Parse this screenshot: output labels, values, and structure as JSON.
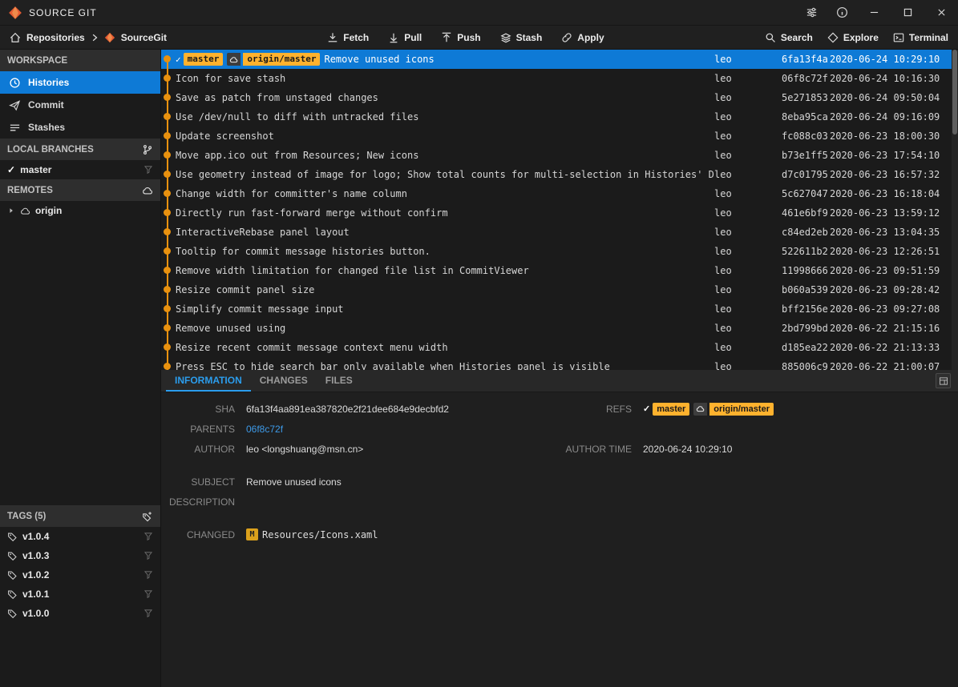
{
  "titlebar": {
    "title": "SOURCE GIT"
  },
  "toolbar": {
    "breadcrumb": {
      "root": "Repositories",
      "repo": "SourceGit"
    },
    "actions": [
      {
        "name": "fetch",
        "label": "Fetch"
      },
      {
        "name": "pull",
        "label": "Pull"
      },
      {
        "name": "push",
        "label": "Push"
      },
      {
        "name": "stash",
        "label": "Stash"
      },
      {
        "name": "apply",
        "label": "Apply"
      }
    ],
    "right_actions": [
      {
        "name": "search",
        "label": "Search"
      },
      {
        "name": "explore",
        "label": "Explore"
      },
      {
        "name": "terminal",
        "label": "Terminal"
      }
    ]
  },
  "sidebar": {
    "workspace_header": "WORKSPACE",
    "workspace_items": [
      {
        "name": "histories",
        "label": "Histories",
        "selected": true
      },
      {
        "name": "commit",
        "label": "Commit",
        "selected": false
      },
      {
        "name": "stashes",
        "label": "Stashes",
        "selected": false
      }
    ],
    "local_branches_header": "LOCAL BRANCHES",
    "branches": [
      {
        "label": "master",
        "current": true
      }
    ],
    "remotes_header": "REMOTES",
    "remotes": [
      {
        "label": "origin"
      }
    ],
    "tags_header": "TAGS (5)",
    "tags": [
      {
        "label": "v1.0.4"
      },
      {
        "label": "v1.0.3"
      },
      {
        "label": "v1.0.2"
      },
      {
        "label": "v1.0.1"
      },
      {
        "label": "v1.0.0"
      }
    ]
  },
  "history": {
    "commits": [
      {
        "refs": [
          {
            "type": "head",
            "name": "master"
          },
          {
            "type": "remote",
            "name": "origin/master"
          }
        ],
        "subject": "Remove unused icons",
        "author": "leo",
        "sha": "6fa13f4a",
        "time": "2020-06-24 10:29:10",
        "selected": true
      },
      {
        "subject": "Icon for save stash",
        "author": "leo",
        "sha": "06f8c72f",
        "time": "2020-06-24 10:16:30"
      },
      {
        "subject": "Save as patch from unstaged changes",
        "author": "leo",
        "sha": "5e271853",
        "time": "2020-06-24 09:50:04"
      },
      {
        "subject": "Use /dev/null to diff with untracked files",
        "author": "leo",
        "sha": "8eba95ca",
        "time": "2020-06-24 09:16:09"
      },
      {
        "subject": "Update screenshot",
        "author": "leo",
        "sha": "fc088c03",
        "time": "2020-06-23 18:00:30"
      },
      {
        "subject": "Move app.ico out from Resources; New icons",
        "author": "leo",
        "sha": "b73e1ff5",
        "time": "2020-06-23 17:54:10"
      },
      {
        "subject": "Use geometry instead of image for logo; Show total counts for multi-selection in Histories' DataGrid",
        "author": "leo",
        "sha": "d7c01795",
        "time": "2020-06-23 16:57:32"
      },
      {
        "subject": "Change width for committer's name column",
        "author": "leo",
        "sha": "5c627047",
        "time": "2020-06-23 16:18:04"
      },
      {
        "subject": "Directly run fast-forward merge without confirm",
        "author": "leo",
        "sha": "461e6bf9",
        "time": "2020-06-23 13:59:12"
      },
      {
        "subject": "InteractiveRebase panel layout",
        "author": "leo",
        "sha": "c84ed2eb",
        "time": "2020-06-23 13:04:35"
      },
      {
        "subject": "Tooltip for commit message histories button.",
        "author": "leo",
        "sha": "522611b2",
        "time": "2020-06-23 12:26:51"
      },
      {
        "subject": "Remove width limitation for changed file list in CommitViewer",
        "author": "leo",
        "sha": "11998666",
        "time": "2020-06-23 09:51:59"
      },
      {
        "subject": "Resize commit panel size",
        "author": "leo",
        "sha": "b060a539",
        "time": "2020-06-23 09:28:42"
      },
      {
        "subject": "Simplify commit message input",
        "author": "leo",
        "sha": "bff2156e",
        "time": "2020-06-23 09:27:08"
      },
      {
        "subject": "Remove unused using",
        "author": "leo",
        "sha": "2bd799bd",
        "time": "2020-06-22 21:15:16"
      },
      {
        "subject": "Resize recent commit message context menu width",
        "author": "leo",
        "sha": "d185ea22",
        "time": "2020-06-22 21:13:33"
      },
      {
        "subject": "Press ESC to hide search bar only available when Histories panel is visible",
        "author": "leo",
        "sha": "885006c9",
        "time": "2020-06-22 21:00:07"
      }
    ]
  },
  "detail": {
    "tabs": [
      {
        "label": "INFORMATION",
        "active": true
      },
      {
        "label": "CHANGES",
        "active": false
      },
      {
        "label": "FILES",
        "active": false
      }
    ],
    "labels": {
      "sha": "SHA",
      "refs": "REFS",
      "parents": "PARENTS",
      "author": "AUTHOR",
      "author_time": "AUTHOR TIME",
      "subject": "SUBJECT",
      "description": "DESCRIPTION",
      "changed": "CHANGED"
    },
    "values": {
      "sha": "6fa13f4aa891ea387820e2f21dee684e9decbfd2",
      "parents": "06f8c72f",
      "author": "leo <longshuang@msn.cn>",
      "author_time": "2020-06-24 10:29:10",
      "subject": "Remove unused icons",
      "description": "",
      "changed_status": "M",
      "changed_file": "Resources/Icons.xaml"
    },
    "refs": [
      {
        "type": "head",
        "name": "master"
      },
      {
        "type": "remote",
        "name": "origin/master"
      }
    ]
  },
  "colors": {
    "accent_blue": "#0e7ad6",
    "badge_orange": "#ffb22e",
    "graph_orange": "#e8910f",
    "link_blue": "#3d9ae8"
  }
}
